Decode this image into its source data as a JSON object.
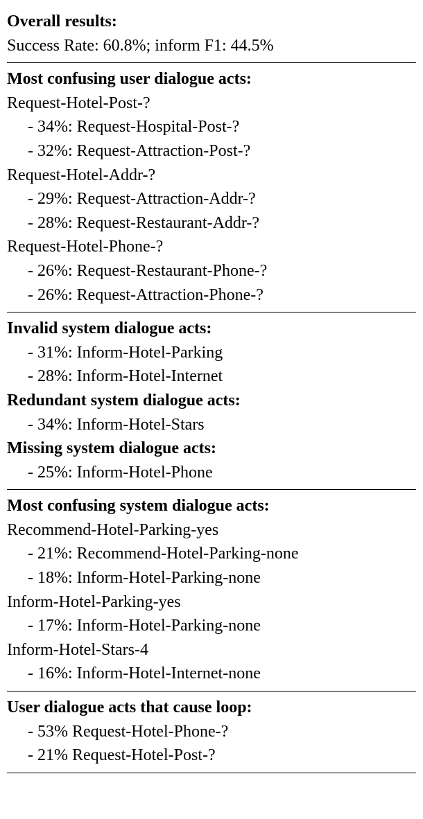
{
  "overall": {
    "heading": "Overall results:",
    "line": "Success Rate: 60.8%; inform F1: 44.5%"
  },
  "confusing_user": {
    "heading": "Most confusing user dialogue acts:",
    "items": [
      {
        "label": "Request-Hotel-Post-?",
        "subs": [
          "- 34%: Request-Hospital-Post-?",
          "- 32%: Request-Attraction-Post-?"
        ]
      },
      {
        "label": "Request-Hotel-Addr-?",
        "subs": [
          "- 29%: Request-Attraction-Addr-?",
          "- 28%: Request-Restaurant-Addr-?"
        ]
      },
      {
        "label": "Request-Hotel-Phone-?",
        "subs": [
          "- 26%: Request-Restaurant-Phone-?",
          "- 26%: Request-Attraction-Phone-?"
        ]
      }
    ]
  },
  "invalid_sys": {
    "heading": "Invalid system dialogue acts:",
    "subs": [
      "- 31%: Inform-Hotel-Parking",
      "- 28%: Inform-Hotel-Internet"
    ]
  },
  "redundant_sys": {
    "heading": "Redundant system dialogue acts:",
    "subs": [
      "- 34%: Inform-Hotel-Stars"
    ]
  },
  "missing_sys": {
    "heading": "Missing system dialogue acts:",
    "subs": [
      "- 25%: Inform-Hotel-Phone"
    ]
  },
  "confusing_sys": {
    "heading": "Most confusing system dialogue acts:",
    "items": [
      {
        "label": "Recommend-Hotel-Parking-yes",
        "subs": [
          "- 21%: Recommend-Hotel-Parking-none",
          "- 18%: Inform-Hotel-Parking-none"
        ]
      },
      {
        "label": "Inform-Hotel-Parking-yes",
        "subs": [
          "- 17%: Inform-Hotel-Parking-none"
        ]
      },
      {
        "label": "Inform-Hotel-Stars-4",
        "subs": [
          "- 16%: Inform-Hotel-Internet-none"
        ]
      }
    ]
  },
  "loop": {
    "heading": "User dialogue acts that cause loop:",
    "subs": [
      "- 53% Request-Hotel-Phone-?",
      "- 21% Request-Hotel-Post-?"
    ]
  }
}
